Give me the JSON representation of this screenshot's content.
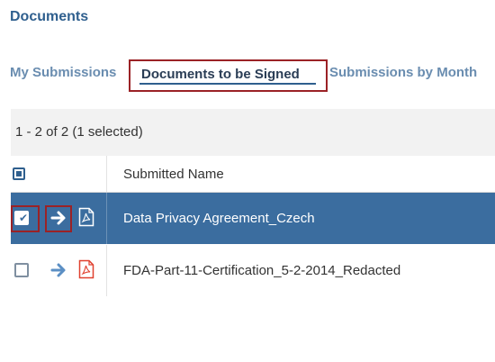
{
  "page": {
    "title": "Documents"
  },
  "tabs": [
    {
      "label": "My Submissions",
      "selected": false
    },
    {
      "label": "Documents to be Signed",
      "selected": true
    },
    {
      "label": "Submissions by Month",
      "selected": false
    }
  ],
  "table": {
    "count_text": "1 - 2 of 2 (1 selected)",
    "header": {
      "name_col": "Submitted Name"
    },
    "rows": [
      {
        "name": "Data Privacy Agreement_Czech",
        "selected": true,
        "icons": [
          "checkbox-icon",
          "arrow-right-icon",
          "pdf-icon"
        ]
      },
      {
        "name": "FDA-Part-11-Certification_5-2-2014_Redacted",
        "selected": false,
        "icons": [
          "checkbox-icon",
          "arrow-right-icon",
          "pdf-icon"
        ]
      }
    ]
  },
  "colors": {
    "accent": "#2f5f8e",
    "selected_row": "#3b6d9f",
    "highlight_outline": "#9b2226",
    "pdf_red": "#e0412f"
  }
}
